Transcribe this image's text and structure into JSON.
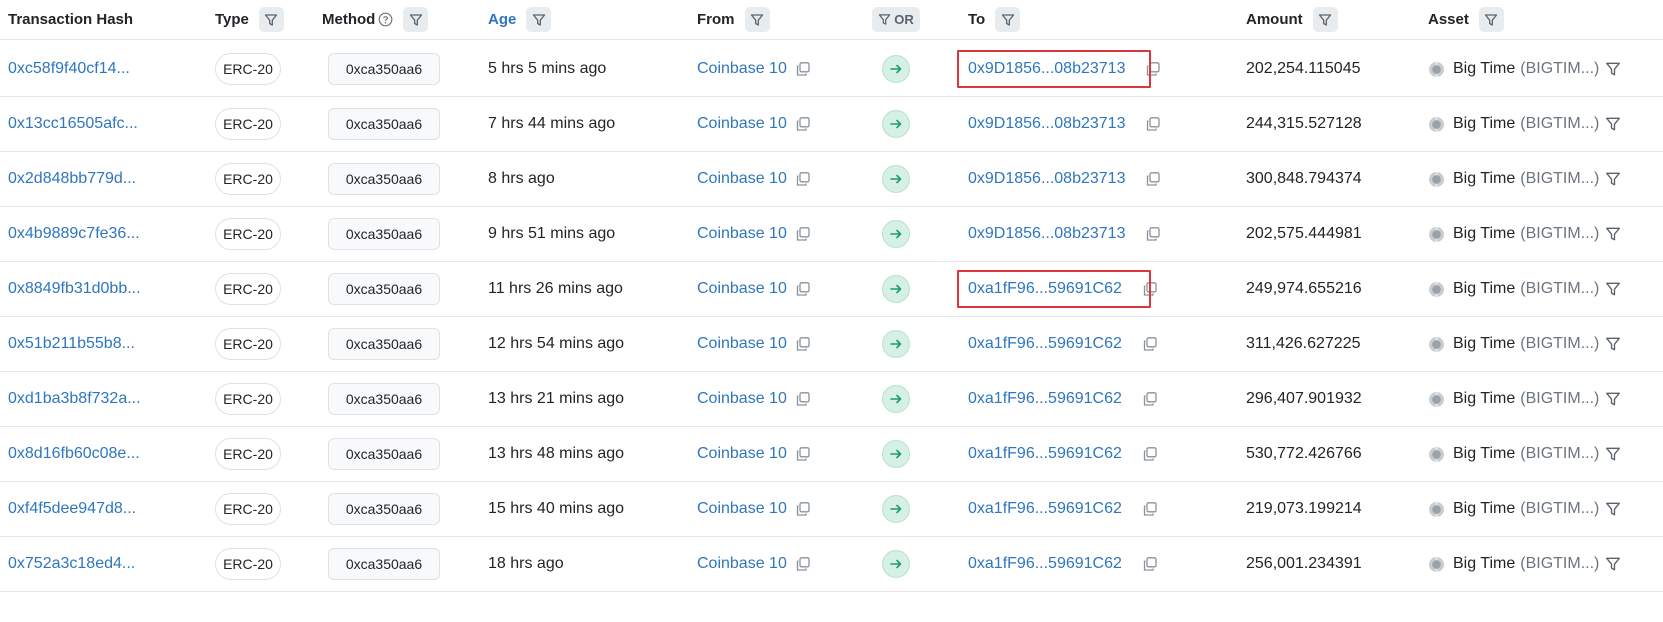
{
  "header": {
    "tx_hash": "Transaction Hash",
    "type": "Type",
    "method": "Method",
    "age": "Age",
    "from": "From",
    "or": "OR",
    "to": "To",
    "amount": "Amount",
    "asset": "Asset"
  },
  "colors": {
    "link": "#2e76c0",
    "highlight": "#d9363e",
    "arrow_bg": "#d7f0e4",
    "arrow_fg": "#1a9e6b"
  },
  "rows": [
    {
      "hash": "0xc58f9f40cf14...",
      "type": "ERC-20",
      "method": "0xca350aa6",
      "age": "5 hrs 5 mins ago",
      "from": "Coinbase 10",
      "to": "0x9D1856...08b23713",
      "amount": "202,254.115045",
      "asset_name": "Big Time",
      "asset_symbol": "(BIGTIM...)",
      "highlighted": true
    },
    {
      "hash": "0x13cc16505afc...",
      "type": "ERC-20",
      "method": "0xca350aa6",
      "age": "7 hrs 44 mins ago",
      "from": "Coinbase 10",
      "to": "0x9D1856...08b23713",
      "amount": "244,315.527128",
      "asset_name": "Big Time",
      "asset_symbol": "(BIGTIM...)",
      "highlighted": false
    },
    {
      "hash": "0x2d848bb779d...",
      "type": "ERC-20",
      "method": "0xca350aa6",
      "age": "8 hrs ago",
      "from": "Coinbase 10",
      "to": "0x9D1856...08b23713",
      "amount": "300,848.794374",
      "asset_name": "Big Time",
      "asset_symbol": "(BIGTIM...)",
      "highlighted": false
    },
    {
      "hash": "0x4b9889c7fe36...",
      "type": "ERC-20",
      "method": "0xca350aa6",
      "age": "9 hrs 51 mins ago",
      "from": "Coinbase 10",
      "to": "0x9D1856...08b23713",
      "amount": "202,575.444981",
      "asset_name": "Big Time",
      "asset_symbol": "(BIGTIM...)",
      "highlighted": false
    },
    {
      "hash": "0x8849fb31d0bb...",
      "type": "ERC-20",
      "method": "0xca350aa6",
      "age": "11 hrs 26 mins ago",
      "from": "Coinbase 10",
      "to": "0xa1fF96...59691C62",
      "amount": "249,974.655216",
      "asset_name": "Big Time",
      "asset_symbol": "(BIGTIM...)",
      "highlighted": true
    },
    {
      "hash": "0x51b211b55b8...",
      "type": "ERC-20",
      "method": "0xca350aa6",
      "age": "12 hrs 54 mins ago",
      "from": "Coinbase 10",
      "to": "0xa1fF96...59691C62",
      "amount": "311,426.627225",
      "asset_name": "Big Time",
      "asset_symbol": "(BIGTIM...)",
      "highlighted": false
    },
    {
      "hash": "0xd1ba3b8f732a...",
      "type": "ERC-20",
      "method": "0xca350aa6",
      "age": "13 hrs 21 mins ago",
      "from": "Coinbase 10",
      "to": "0xa1fF96...59691C62",
      "amount": "296,407.901932",
      "asset_name": "Big Time",
      "asset_symbol": "(BIGTIM...)",
      "highlighted": false
    },
    {
      "hash": "0x8d16fb60c08e...",
      "type": "ERC-20",
      "method": "0xca350aa6",
      "age": "13 hrs 48 mins ago",
      "from": "Coinbase 10",
      "to": "0xa1fF96...59691C62",
      "amount": "530,772.426766",
      "asset_name": "Big Time",
      "asset_symbol": "(BIGTIM...)",
      "highlighted": false
    },
    {
      "hash": "0xf4f5dee947d8...",
      "type": "ERC-20",
      "method": "0xca350aa6",
      "age": "15 hrs 40 mins ago",
      "from": "Coinbase 10",
      "to": "0xa1fF96...59691C62",
      "amount": "219,073.199214",
      "asset_name": "Big Time",
      "asset_symbol": "(BIGTIM...)",
      "highlighted": false
    },
    {
      "hash": "0x752a3c18ed4...",
      "type": "ERC-20",
      "method": "0xca350aa6",
      "age": "18 hrs ago",
      "from": "Coinbase 10",
      "to": "0xa1fF96...59691C62",
      "amount": "256,001.234391",
      "asset_name": "Big Time",
      "asset_symbol": "(BIGTIM...)",
      "highlighted": false
    }
  ]
}
